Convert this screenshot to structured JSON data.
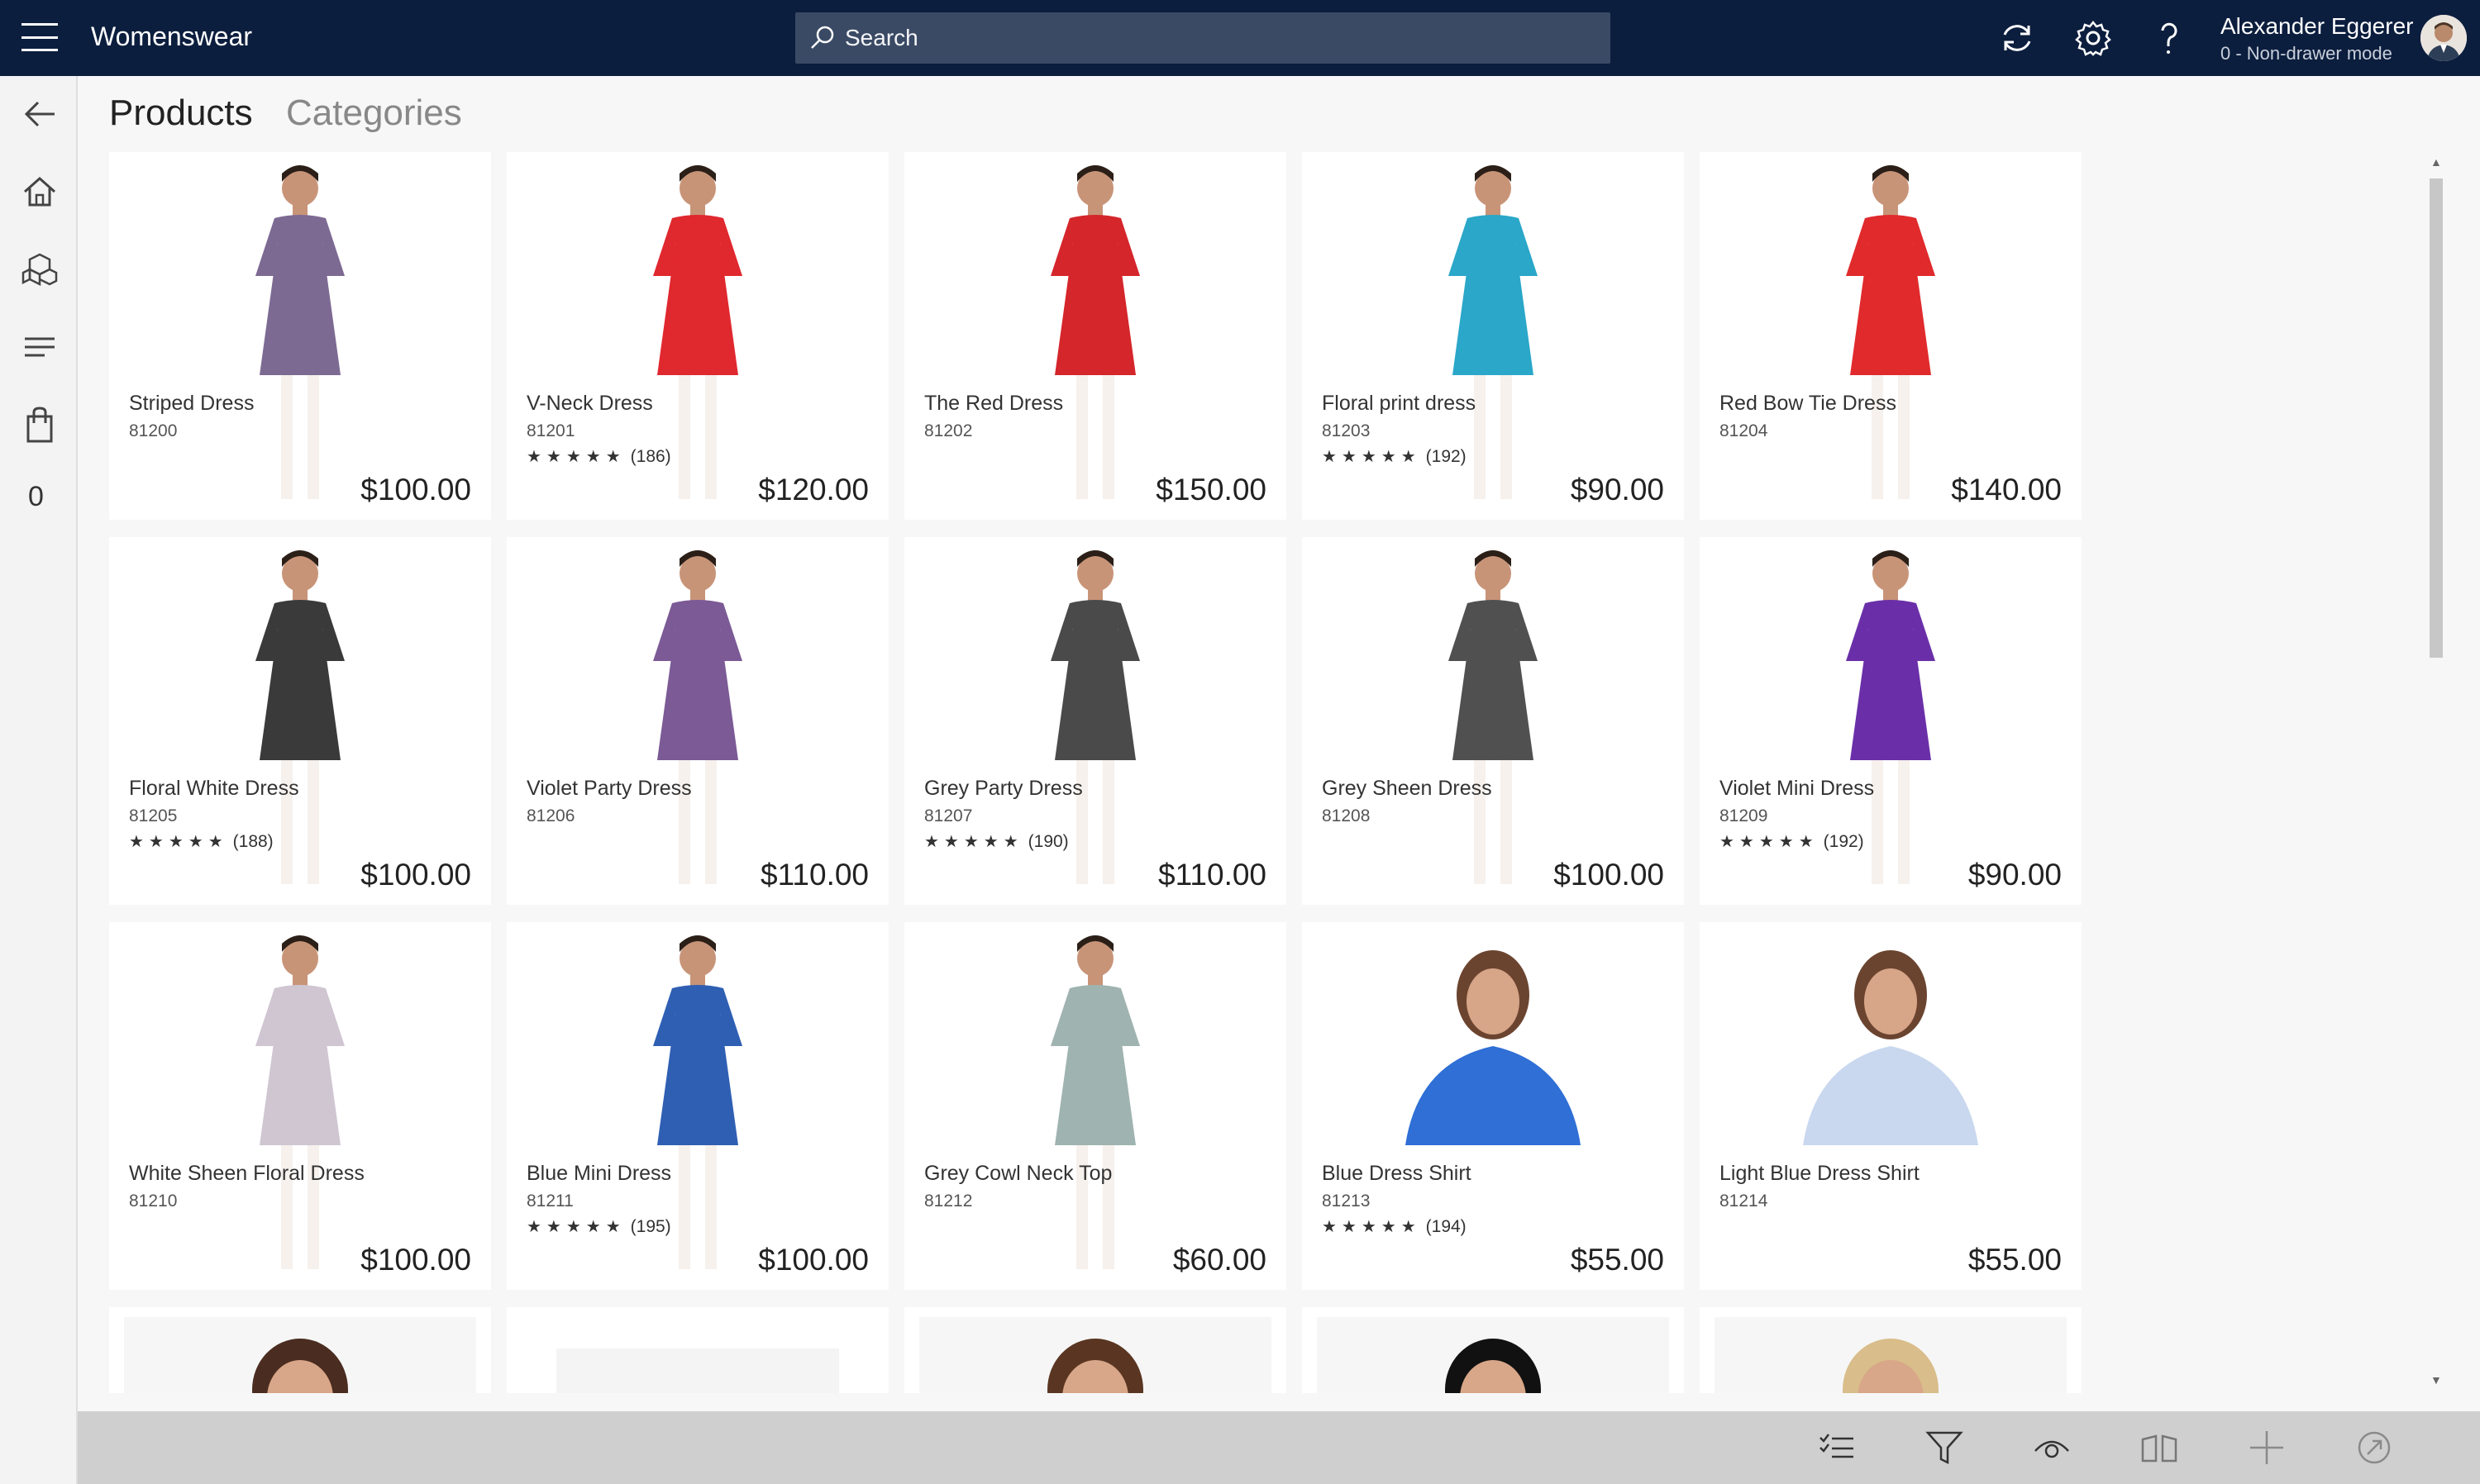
{
  "app": {
    "title": "Womenswear"
  },
  "search": {
    "placeholder": "Search"
  },
  "user": {
    "name": "Alexander Eggerer",
    "mode": "0 - Non-drawer mode"
  },
  "top_icons": [
    "refresh-icon",
    "settings-gear-icon",
    "help-question-icon"
  ],
  "left_rail": {
    "items": [
      "back-arrow-icon",
      "home-icon",
      "products-cubes-icon",
      "list-icon",
      "shopping-bag-icon"
    ],
    "cart_count": "0"
  },
  "tabs": {
    "products": "Products",
    "categories": "Categories"
  },
  "products": [
    {
      "name": "Striped Dress",
      "sku": "81200",
      "stars": "",
      "reviews": "",
      "price": "$100.00",
      "color": "#7d6a93"
    },
    {
      "name": "V-Neck Dress",
      "sku": "81201",
      "stars": "★★★★★",
      "reviews": "(186)",
      "price": "$120.00",
      "color": "#e0282f"
    },
    {
      "name": "The Red Dress",
      "sku": "81202",
      "stars": "",
      "reviews": "",
      "price": "$150.00",
      "color": "#d4262b"
    },
    {
      "name": "Floral print dress",
      "sku": "81203",
      "stars": "★★★★★",
      "reviews": "(192)",
      "price": "$90.00",
      "color": "#2aa7c9"
    },
    {
      "name": "Red Bow Tie Dress",
      "sku": "81204",
      "stars": "",
      "reviews": "",
      "price": "$140.00",
      "color": "#e02a2c"
    },
    {
      "name": "Floral White Dress",
      "sku": "81205",
      "stars": "★★★★★",
      "reviews": "(188)",
      "price": "$100.00",
      "color": "#3a3a3a"
    },
    {
      "name": "Violet Party Dress",
      "sku": "81206",
      "stars": "",
      "reviews": "",
      "price": "$110.00",
      "color": "#7b5a96"
    },
    {
      "name": "Grey Party Dress",
      "sku": "81207",
      "stars": "★★★★★",
      "reviews": "(190)",
      "price": "$110.00",
      "color": "#4a4a4a"
    },
    {
      "name": "Grey Sheen Dress",
      "sku": "81208",
      "stars": "",
      "reviews": "",
      "price": "$100.00",
      "color": "#505050"
    },
    {
      "name": "Violet Mini Dress",
      "sku": "81209",
      "stars": "★★★★★",
      "reviews": "(192)",
      "price": "$90.00",
      "color": "#6a2fa8"
    },
    {
      "name": "White Sheen Floral Dress",
      "sku": "81210",
      "stars": "",
      "reviews": "",
      "price": "$100.00",
      "color": "#cfc6d2"
    },
    {
      "name": "Blue Mini Dress",
      "sku": "81211",
      "stars": "★★★★★",
      "reviews": "(195)",
      "price": "$100.00",
      "color": "#2f5fb3"
    },
    {
      "name": "Grey Cowl Neck Top",
      "sku": "81212",
      "stars": "",
      "reviews": "",
      "price": "$60.00",
      "color": "#9fb3b0"
    },
    {
      "name": "Blue Dress Shirt",
      "sku": "81213",
      "stars": "★★★★★",
      "reviews": "(194)",
      "price": "$55.00",
      "color": "#2f6fd6"
    },
    {
      "name": "Light Blue Dress Shirt",
      "sku": "81214",
      "stars": "",
      "reviews": "",
      "price": "$55.00",
      "color": "#c9d8ef"
    }
  ],
  "command_bar": [
    "checklist-icon",
    "filter-icon",
    "view-eye-icon",
    "compare-icon",
    "add-plus-icon",
    "navigate-arrow-icon",
    "more-ellipsis-icon"
  ]
}
